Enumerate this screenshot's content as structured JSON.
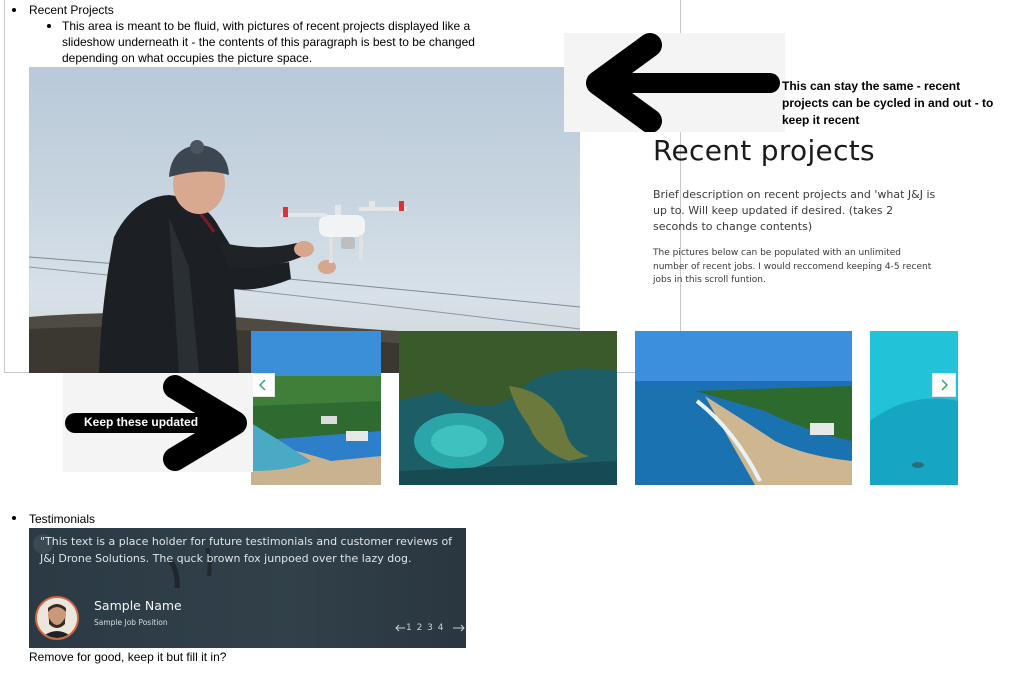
{
  "section1": {
    "heading": "Recent Projects",
    "note": "This area is meant to be fluid, with pictures of recent projects displayed like a slideshow underneath it - the contents of this paragraph is best to be changed depending on what occupies the picture space."
  },
  "callouts": {
    "top": "This can stay the same - recent projects can be cycled in and out - to keep it recent",
    "left": "Keep these updated"
  },
  "recent_projects": {
    "title": "Recent projects",
    "description": "Brief description on recent projects and 'what J&J is up to. Will keep updated if desired. (takes 2 seconds to change contents)",
    "subtext": "The pictures below can be populated with an unlimited number of recent jobs. I would reccomend keeping 4-5 recent jobs in this scroll funtion."
  },
  "gallery": {
    "prev_icon": "chevron-left-icon",
    "next_icon": "chevron-right-icon",
    "accent": "#3aa57a"
  },
  "section2": {
    "heading": "Testimonials"
  },
  "testimonial": {
    "quote": "\"This text is a place holder for future testimonials and customer reviews of J&j Drone Solutions. The quck brown fox junpoed over the lazy dog.",
    "name": "Sample Name",
    "job": "Sample Job Position",
    "pager": "1 2 3 4",
    "prev_icon": "arrow-left-icon",
    "next_icon": "arrow-right-icon"
  },
  "footer_note": "Remove for good, keep it but fill it in?"
}
